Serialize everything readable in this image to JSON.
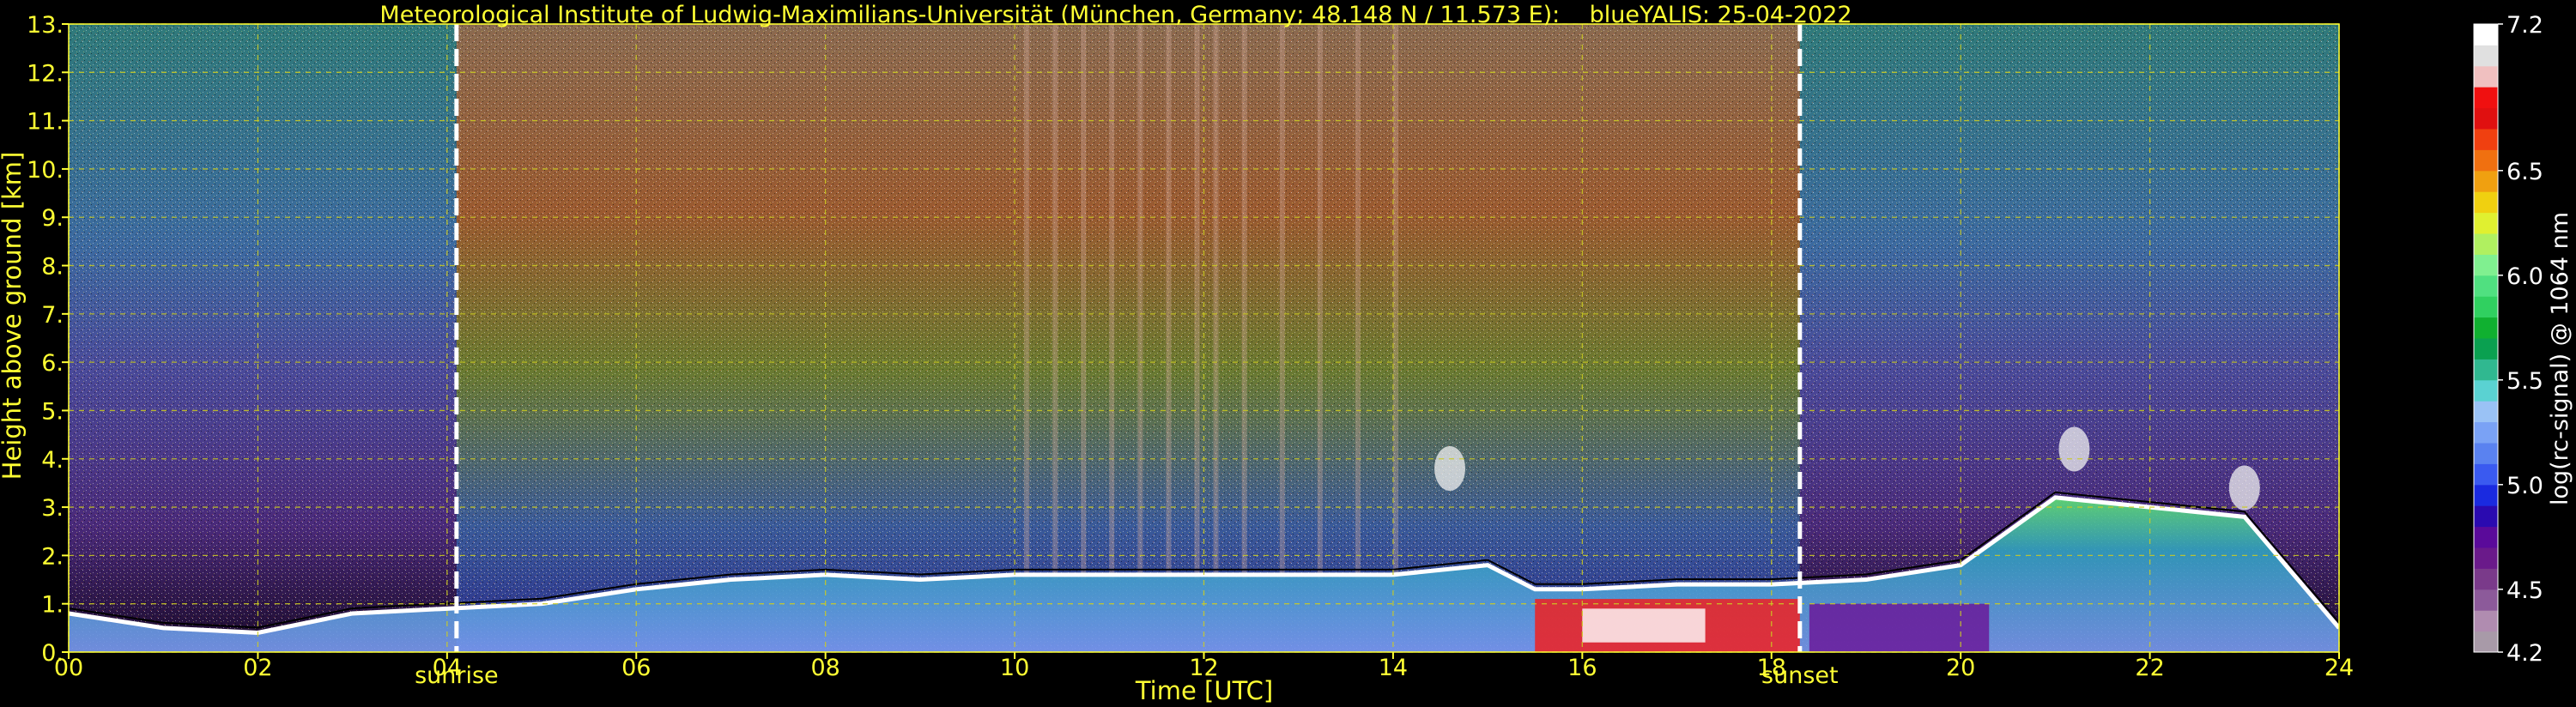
{
  "chart_data": {
    "type": "heatmap",
    "title": "Meteorological Institute of Ludwig-Maximilians-Universität (München, Germany; 48.148 N / 11.573 E):    blueYALIS: 25-04-2022",
    "xlabel": "Time [UTC]",
    "ylabel": "Height above ground [km]",
    "xlim": [
      0,
      24
    ],
    "ylim": [
      0,
      13
    ],
    "x_ticks": [
      "00",
      "02",
      "04",
      "06",
      "08",
      "10",
      "12",
      "14",
      "16",
      "18",
      "20",
      "22",
      "24"
    ],
    "y_ticks": [
      "0.",
      "1.",
      "2.",
      "3.",
      "4.",
      "5.",
      "6.",
      "7.",
      "8.",
      "9.",
      "10.",
      "11.",
      "12.",
      "13."
    ],
    "grid": true,
    "events": [
      {
        "label": "sunrise",
        "time": 4.1
      },
      {
        "label": "sunset",
        "time": 18.3
      }
    ],
    "colorbar": {
      "label": "log(rc-signal) @ 1064 nm",
      "range": [
        4.2,
        7.2
      ],
      "ticks": [
        "4.2",
        "4.5",
        "5.0",
        "5.5",
        "6.0",
        "6.5",
        "7.2"
      ],
      "colors": [
        "#a89aa8",
        "#b08cb0",
        "#8c5a9a",
        "#7a3a8a",
        "#6a1a8a",
        "#5a0a9a",
        "#2a0ab0",
        "#1a2ae0",
        "#3a5af0",
        "#5a82f0",
        "#7aa2f5",
        "#9ac2f5",
        "#5ad2d2",
        "#30b890",
        "#0aa050",
        "#10b030",
        "#30d060",
        "#50e080",
        "#80f090",
        "#b0f060",
        "#e0f030",
        "#f0d010",
        "#f0a010",
        "#f07010",
        "#f04010",
        "#e01010",
        "#f01010",
        "#f0c0c0",
        "#e0e0e0",
        "#ffffff"
      ]
    },
    "layers": [
      {
        "name": "night-background",
        "t_start": 0,
        "t_end": 4.1,
        "note": "blue-green noise fading to purple below 5 km"
      },
      {
        "name": "daytime-background",
        "t_start": 4.1,
        "t_end": 18.3,
        "note": "green to orange-red noise, white speckle aloft"
      },
      {
        "name": "night-background",
        "t_start": 18.3,
        "t_end": 24,
        "note": "blue-green noise fading to purple below 5 km"
      }
    ],
    "boundary_layer": {
      "time": [
        0,
        1,
        2,
        3,
        4,
        5,
        6,
        7,
        8,
        9,
        10,
        11,
        12,
        13,
        14,
        15,
        15.5,
        16,
        17,
        18,
        19,
        20,
        21,
        22,
        23,
        24
      ],
      "top_km": [
        0.8,
        0.5,
        0.4,
        0.8,
        0.9,
        1.0,
        1.3,
        1.5,
        1.6,
        1.5,
        1.6,
        1.6,
        1.6,
        1.6,
        1.6,
        1.8,
        1.3,
        1.3,
        1.4,
        1.4,
        1.5,
        1.8,
        3.2,
        3.0,
        2.8,
        0.5
      ]
    },
    "cloud_features": [
      {
        "t": 14.6,
        "h_km": 3.8,
        "note": "small cloud"
      },
      {
        "t": 21.2,
        "h_km": 4.2,
        "note": "cloud layer"
      },
      {
        "t": 23.0,
        "h_km": 3.4,
        "note": "cloud layer"
      }
    ]
  }
}
